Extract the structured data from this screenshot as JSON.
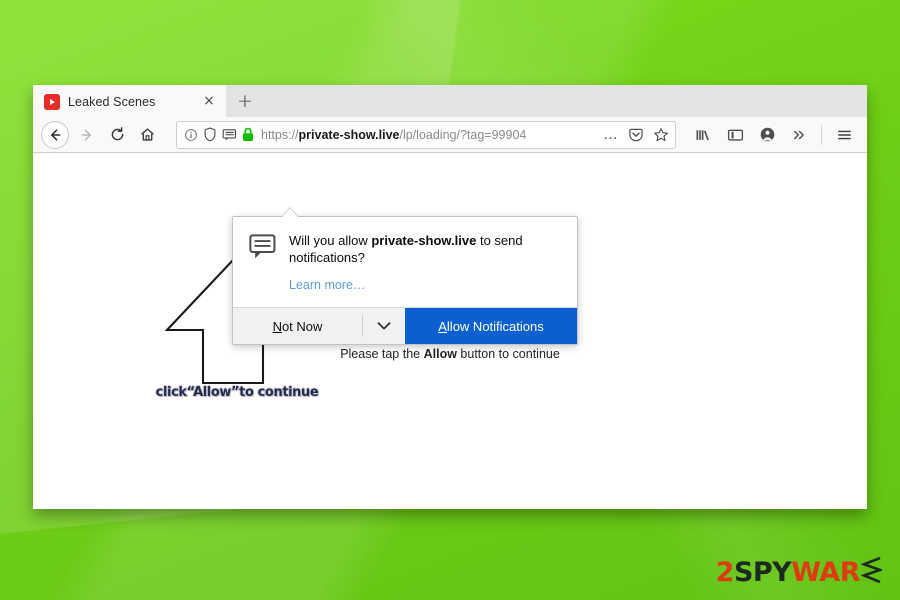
{
  "background": {
    "color": "#72d41a"
  },
  "browser": {
    "tab": {
      "title": "Leaked Scenes",
      "favicon": "youtube-play-icon",
      "close_label": "×",
      "newtab_label": "+"
    },
    "toolbar": {
      "back_label": "back-arrow",
      "forward_label": "forward-arrow",
      "reload_label": "reload-arrow",
      "home_label": "home-house",
      "url_scheme": "https://",
      "url_host": "private-show.live",
      "url_path": "/lp/loading/?tag=99904",
      "page_actions_label": "…",
      "identity_icons": [
        "info-icon",
        "shield-icon",
        "notification-permission-icon",
        "padlock-icon"
      ],
      "right_icons": [
        "library-icon",
        "sidebar-icon",
        "account-icon",
        "overflow-icon",
        "menu-icon"
      ]
    }
  },
  "page": {
    "arrow_caption": "click“Allow”to continue",
    "loader_prefix": "Please tap the ",
    "loader_bold": "Allow",
    "loader_suffix": " button to continue"
  },
  "doorhanger": {
    "icon": "speech-bubble-icon",
    "message_prefix": "Will you allow ",
    "message_host": "private-show.live",
    "message_suffix": " to send notifications?",
    "learn_more": "Learn more…",
    "secondary_accesskey": "N",
    "secondary_rest": "ot Now",
    "caret": "chevron-down-icon",
    "primary_accesskey": "A",
    "primary_rest": "llow Notifications",
    "primary_color": "#0a60d0"
  },
  "watermark": {
    "part1": "2",
    "part2": "SPY",
    "part3": "WAR",
    "part4": "E",
    "color_accent": "#e03a12",
    "color_dark": "#1c2a20"
  }
}
